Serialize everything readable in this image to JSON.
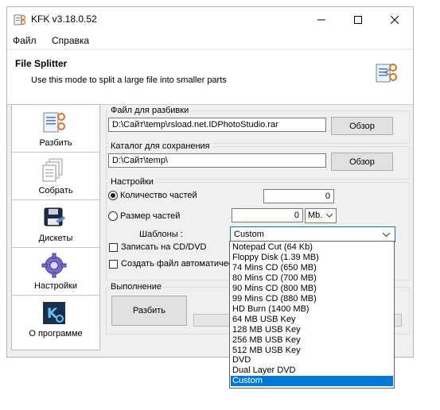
{
  "window": {
    "title": "KFK v3.18.0.52",
    "menu": [
      "Файл",
      "Справка"
    ]
  },
  "header": {
    "title": "File Splitter",
    "subtitle": "Use this mode to split a large file into smaller parts"
  },
  "sidebar": {
    "items": [
      {
        "label": "Разбить",
        "icon": "split-icon"
      },
      {
        "label": "Собрать",
        "icon": "join-icon"
      },
      {
        "label": "Дискеты",
        "icon": "floppy-icon"
      },
      {
        "label": "Настройки",
        "icon": "settings-gear-icon"
      },
      {
        "label": "О программе",
        "icon": "about-icon"
      }
    ]
  },
  "source": {
    "label": "Файл для разбивки",
    "value": "D:\\Сайт\\temp\\rsload.net.IDPhotoStudio.rar",
    "browse": "Обзор"
  },
  "target": {
    "label": "Каталог для сохранения",
    "value": "D:\\Сайт\\temp\\",
    "browse": "Обзор"
  },
  "settings": {
    "label": "Настройки",
    "parts_count_label": "Количество частей",
    "parts_count_value": "0",
    "part_size_label": "Размер частей",
    "part_size_value": "0",
    "unit": "Mb.",
    "templates_label": "Шаблоны :",
    "template_selected": "Custom",
    "burn_cd_label": "Записать на CD/DVD",
    "auto_file_label": "Создать файл автоматически",
    "selected_mode": "parts_count"
  },
  "execution": {
    "label": "Выполнение",
    "split_button": "Разбить"
  },
  "template_options": [
    "Notepad Cut (64 Kb)",
    "Floppy Disk (1.39 MB)",
    "74 Mins CD (650 MB)",
    "80 Mins CD (700 MB)",
    "90 Mins CD (800 MB)",
    "99 Mins CD (880 MB)",
    "HD Burn (1400 MB)",
    "64 MB USB Key",
    "128 MB USB Key",
    "256 MB USB Key",
    "512 MB USB Key",
    "DVD",
    "Dual Layer DVD",
    "Custom"
  ],
  "colors": {
    "selection": "#0078d7",
    "window_bg": "#f0f0f0"
  }
}
